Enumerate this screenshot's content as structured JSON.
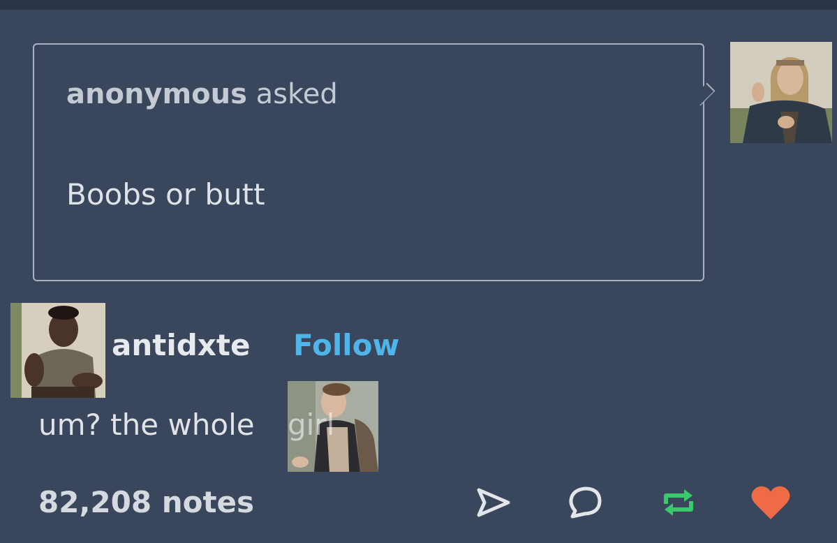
{
  "post": {
    "ask": {
      "asker": "anonymous",
      "asked_label": "asked",
      "question": "Boobs or butt"
    },
    "answerer": {
      "username": "antidxte",
      "follow_label": "Follow"
    },
    "answer": {
      "text": "um? the whole",
      "text_tail": "girl"
    },
    "footer": {
      "notes": "82,208 notes",
      "actions": [
        {
          "icon": "send-icon"
        },
        {
          "icon": "reply-icon"
        },
        {
          "icon": "reblog-icon",
          "color": "#3bc96b"
        },
        {
          "icon": "heart-icon",
          "color": "#ee6b45"
        }
      ]
    }
  },
  "colors": {
    "background": "#3a465c",
    "follow": "#4fb5e8",
    "reblog": "#3bc96b",
    "like": "#ee6b45"
  }
}
